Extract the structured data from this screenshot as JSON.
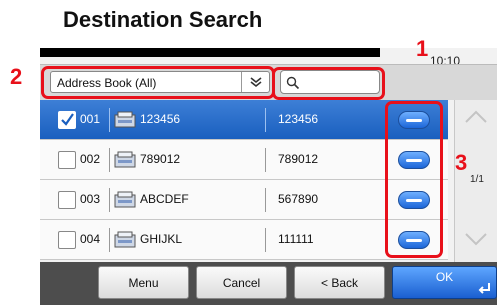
{
  "title": "Destination Search",
  "clock": "10:10",
  "filter": {
    "selected": "Address Book (All)"
  },
  "rows": [
    {
      "num": "001",
      "name": "123456",
      "number": "123456",
      "checked": true
    },
    {
      "num": "002",
      "name": "789012",
      "number": "789012",
      "checked": false
    },
    {
      "num": "003",
      "name": "ABCDEF",
      "number": "567890",
      "checked": false
    },
    {
      "num": "004",
      "name": "GHIJKL",
      "number": "111111",
      "checked": false
    }
  ],
  "page_indicator": "1/1",
  "buttons": {
    "menu": "Menu",
    "cancel": "Cancel",
    "back": "< Back",
    "ok": "OK"
  },
  "callouts": {
    "c1": "1",
    "c2": "2",
    "c3": "3"
  },
  "colors": {
    "accent": "#1a5fbf",
    "callout": "#e8101a"
  },
  "icons": [
    "search-icon",
    "dropdown-arrow-icon",
    "address-book-entry-icon",
    "detail-icon",
    "scroll-up-icon",
    "scroll-down-icon",
    "enter-icon"
  ]
}
